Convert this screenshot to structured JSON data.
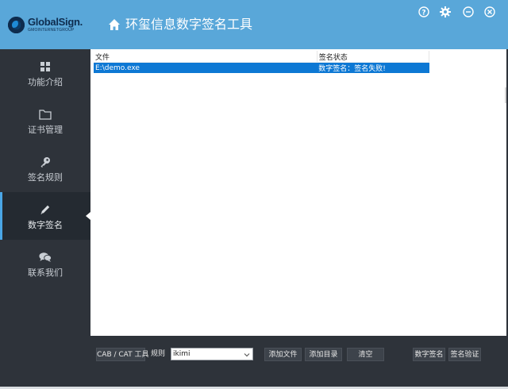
{
  "brand": {
    "name": "GlobalSign.",
    "tagline": "GMOINTERNETGROUP"
  },
  "titlebar": {
    "title": "环玺信息数字签名工具"
  },
  "sidebar": {
    "items": [
      {
        "label": "功能介绍",
        "icon": "grid-icon",
        "active": false
      },
      {
        "label": "证书管理",
        "icon": "folder-icon",
        "active": false
      },
      {
        "label": "签名规则",
        "icon": "key-icon",
        "active": false
      },
      {
        "label": "数字签名",
        "icon": "pencil-icon",
        "active": true
      },
      {
        "label": "联系我们",
        "icon": "chat-bubbles-icon",
        "active": false
      }
    ]
  },
  "window_controls": [
    "help-icon",
    "gear-icon",
    "minimize-icon",
    "close-icon"
  ],
  "table": {
    "columns": [
      "文件",
      "签名状态"
    ],
    "rows": [
      {
        "file": "E:\\demo.exe",
        "status": "数字签名：签名失败!",
        "selected": true
      }
    ]
  },
  "toolbar": {
    "cab_cat_label": "CAB / CAT 工具",
    "rule_label": "规则",
    "rule_value": "ikimi",
    "add_file_label": "添加文件",
    "add_dir_label": "添加目录",
    "clear_label": "清空",
    "sign_label": "数字签名",
    "verify_label": "签名验证"
  },
  "colors": {
    "header_blue": "#59a7d9",
    "sidebar_dark": "#2e333a",
    "selection_blue": "#0d78d4",
    "active_indicator": "#4aa6e6"
  }
}
